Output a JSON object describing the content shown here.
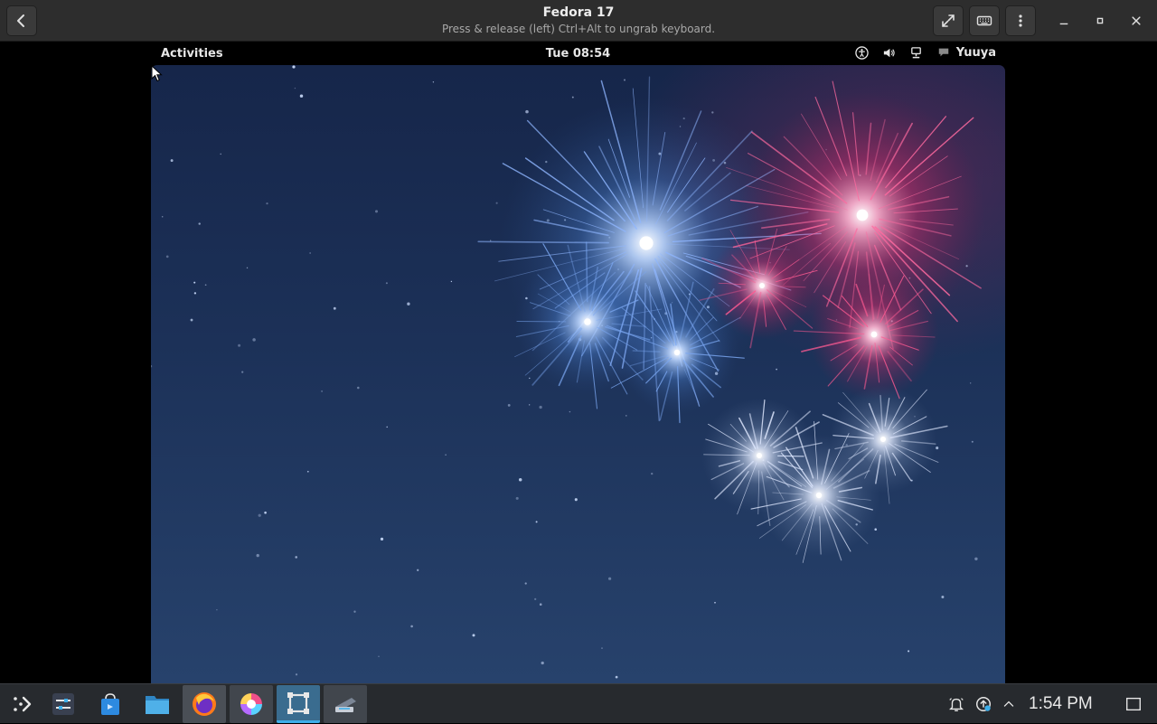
{
  "headerbar": {
    "title": "Fedora 17",
    "subtitle": "Press & release (left) Ctrl+Alt to ungrab keyboard.",
    "buttons": {
      "back": "back-icon",
      "fullscreen": "fullscreen-icon",
      "keyboard": "keyboard-icon",
      "menu": "menu-icon",
      "minimize": "minimize-icon",
      "maximize": "maximize-icon",
      "close": "close-icon"
    }
  },
  "guest": {
    "topbar": {
      "activities": "Activities",
      "clock": "Tue 08:54",
      "user": "Yuuya",
      "status_icons": [
        "accessibility-icon",
        "volume-icon",
        "network-icon",
        "chat-icon"
      ]
    },
    "wallpaper": "fireworks"
  },
  "panel": {
    "launchers": [
      {
        "name": "application-launcher-icon"
      },
      {
        "name": "system-settings-icon"
      },
      {
        "name": "discover-store-icon"
      },
      {
        "name": "file-manager-icon"
      },
      {
        "name": "firefox-icon"
      },
      {
        "name": "kolourpaint-icon"
      },
      {
        "name": "boxes-icon"
      },
      {
        "name": "scanner-icon"
      }
    ],
    "tray_icons": [
      "notifications-icon",
      "updates-icon",
      "expand-tray-icon"
    ],
    "clock": "1:54 PM",
    "show_desktop": "show-desktop-icon"
  },
  "colors": {
    "headerbar_bg": "#2d2d2d",
    "panel_bg": "#272a2e",
    "accent": "#3daee9",
    "firework_blue": "#6fa8ff",
    "firework_pink": "#ff4f8f"
  }
}
